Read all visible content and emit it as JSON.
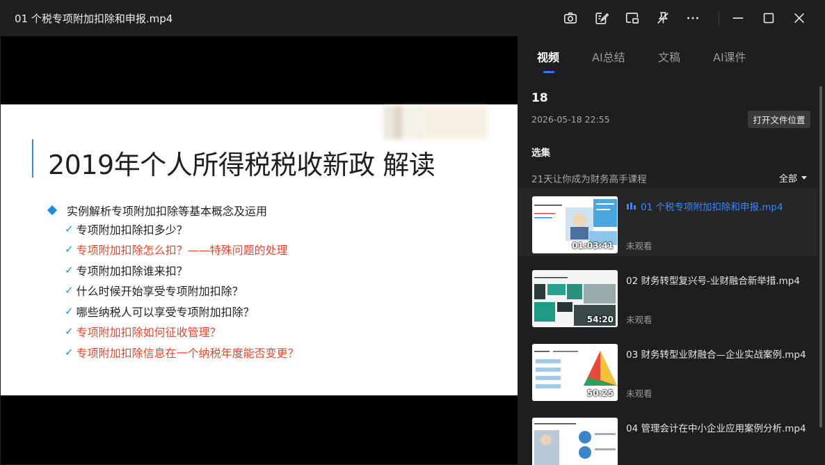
{
  "window": {
    "title": "01 个税专项附加扣除和申报.mp4"
  },
  "slide": {
    "title": "2019年个人所得税税收新政 解读",
    "heading": "实例解析专项附加扣除等基本概念及运用",
    "check_glyph": "✓",
    "items": [
      {
        "text": "专项附加扣除扣多少？",
        "color": "#222222"
      },
      {
        "text": "专项附加扣除怎么扣？——特殊问题的处理",
        "color": "#e8452c"
      },
      {
        "text": "专项附加扣除谁来扣？",
        "color": "#222222"
      },
      {
        "text": "什么时候开始享受专项附加扣除？",
        "color": "#222222"
      },
      {
        "text": "哪些纳税人可以享受专项附加扣除？",
        "color": "#222222"
      },
      {
        "text": "专项附加扣除如何征收管理？",
        "color": "#e8452c"
      },
      {
        "text": "专项附加扣除信息在一个纳税年度能否变更？",
        "color": "#e8452c"
      }
    ]
  },
  "sidebar": {
    "tabs": [
      "视频",
      "AI总结",
      "文稿",
      "AI课件"
    ],
    "active_tab": "视频",
    "count": "18",
    "date": "2026-05-18 22:55",
    "open_location": "打开文件位置",
    "section": "选集",
    "course": "21天让你成为财务高手课程",
    "filter": "全部",
    "episodes": [
      {
        "title": "01 个税专项附加扣除和申报.mp4",
        "duration": "01:03:41",
        "status": "未观看",
        "active": true
      },
      {
        "title": "02 财务转型复兴号-业财融合新举措.mp4",
        "duration": "54:20",
        "status": "未观看",
        "active": false
      },
      {
        "title": "03 财务转型业财融合—企业实战案例.mp4",
        "duration": "50:25",
        "status": "未观看",
        "active": false
      },
      {
        "title": "04 管理会计在中小企业应用案例分析.mp4",
        "duration": "",
        "status": "",
        "active": false
      }
    ]
  },
  "colors": {
    "accent": "#3a86ff",
    "slide_red": "#e8452c",
    "slide_blue": "#1a8fe0"
  },
  "icons": [
    "camera-icon",
    "edit-note-icon",
    "picture-in-picture-icon",
    "pin-off-icon",
    "more-icon",
    "minimize-icon",
    "maximize-icon",
    "close-icon"
  ]
}
